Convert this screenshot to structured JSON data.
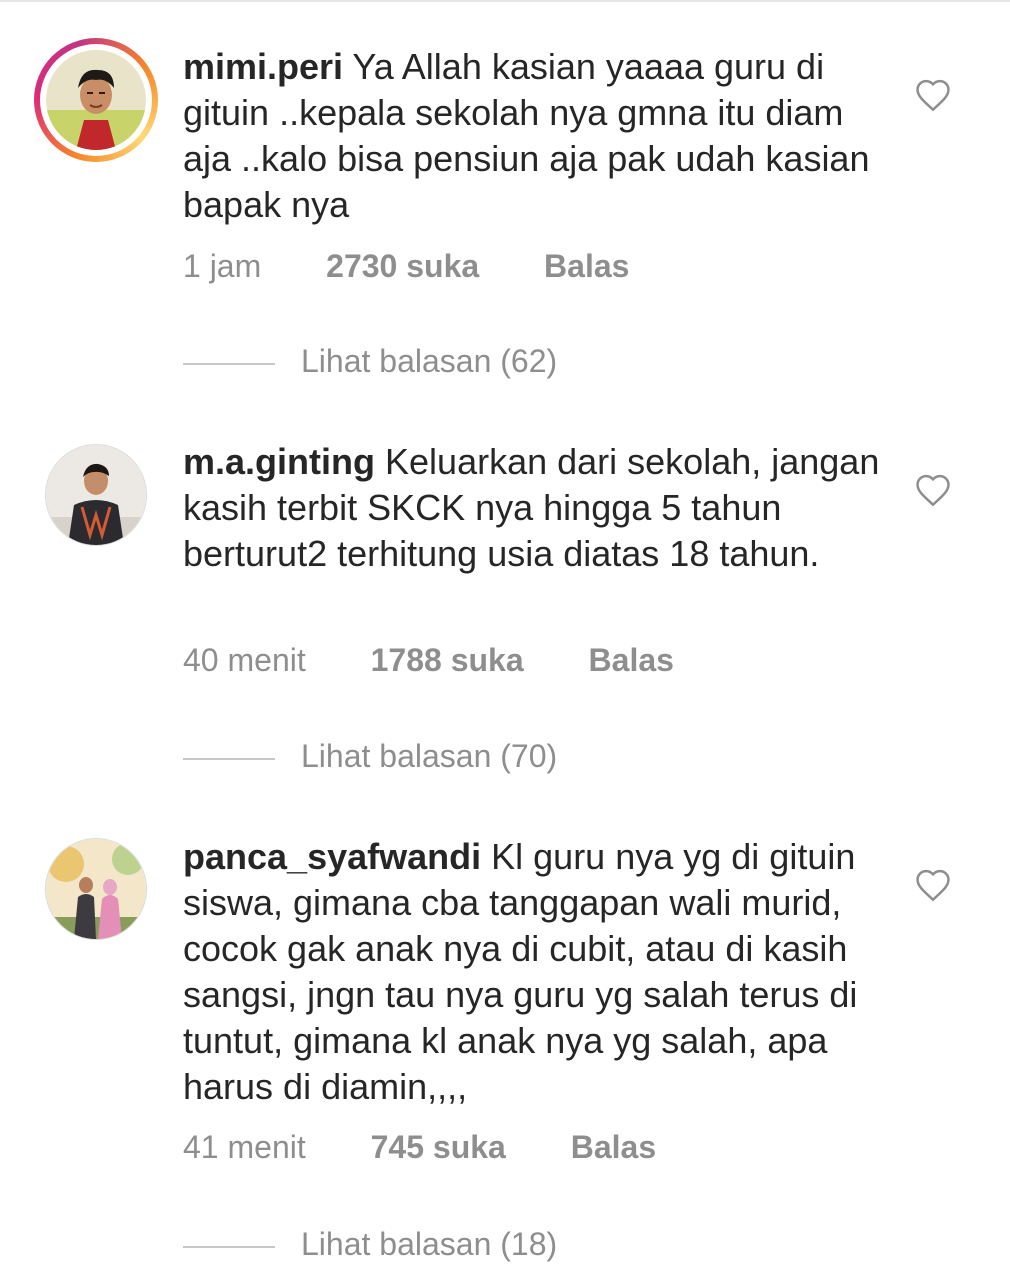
{
  "comments": [
    {
      "username": "mimi.peri",
      "text": "Ya Allah kasian yaaaa guru di gituin ..kepala sekolah nya gmna itu diam aja ..kalo bisa pensiun aja pak udah kasian bapak nya",
      "time": "1 jam",
      "likes": "2730 suka",
      "reply_label": "Balas",
      "view_replies": "Lihat balasan (62)",
      "has_story": true
    },
    {
      "username": "m.a.ginting",
      "text": "Keluarkan dari sekolah, jangan kasih terbit SKCK nya hingga 5 tahun berturut2 terhitung usia diatas 18 tahun.",
      "time": "40 menit",
      "likes": "1788 suka",
      "reply_label": "Balas",
      "view_replies": "Lihat balasan (70)",
      "has_story": false
    },
    {
      "username": "panca_syafwandi",
      "text": "Kl guru nya yg di gituin siswa, gimana cba tanggapan wali murid, cocok gak anak nya di cubit, atau di kasih sangsi, jngn tau nya guru yg salah terus di tuntut, gimana kl anak nya yg salah, apa harus di diamin,,,,",
      "time": "41 menit",
      "likes": "745 suka",
      "reply_label": "Balas",
      "view_replies": "Lihat balasan (18)",
      "has_story": false
    }
  ],
  "colors": {
    "text": "#262626",
    "secondary": "#8e8e8e",
    "divider": "#c7c7c7"
  },
  "icons": {
    "like": "heart-outline-icon"
  }
}
